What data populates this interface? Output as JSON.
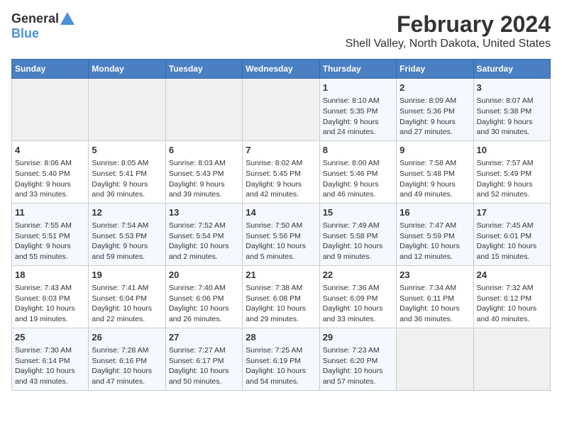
{
  "logo": {
    "general": "General",
    "blue": "Blue"
  },
  "title": "February 2024",
  "subtitle": "Shell Valley, North Dakota, United States",
  "weekdays": [
    "Sunday",
    "Monday",
    "Tuesday",
    "Wednesday",
    "Thursday",
    "Friday",
    "Saturday"
  ],
  "weeks": [
    [
      {
        "day": "",
        "content": ""
      },
      {
        "day": "",
        "content": ""
      },
      {
        "day": "",
        "content": ""
      },
      {
        "day": "",
        "content": ""
      },
      {
        "day": "1",
        "content": "Sunrise: 8:10 AM\nSunset: 5:35 PM\nDaylight: 9 hours\nand 24 minutes."
      },
      {
        "day": "2",
        "content": "Sunrise: 8:09 AM\nSunset: 5:36 PM\nDaylight: 9 hours\nand 27 minutes."
      },
      {
        "day": "3",
        "content": "Sunrise: 8:07 AM\nSunset: 5:38 PM\nDaylight: 9 hours\nand 30 minutes."
      }
    ],
    [
      {
        "day": "4",
        "content": "Sunrise: 8:06 AM\nSunset: 5:40 PM\nDaylight: 9 hours\nand 33 minutes."
      },
      {
        "day": "5",
        "content": "Sunrise: 8:05 AM\nSunset: 5:41 PM\nDaylight: 9 hours\nand 36 minutes."
      },
      {
        "day": "6",
        "content": "Sunrise: 8:03 AM\nSunset: 5:43 PM\nDaylight: 9 hours\nand 39 minutes."
      },
      {
        "day": "7",
        "content": "Sunrise: 8:02 AM\nSunset: 5:45 PM\nDaylight: 9 hours\nand 42 minutes."
      },
      {
        "day": "8",
        "content": "Sunrise: 8:00 AM\nSunset: 5:46 PM\nDaylight: 9 hours\nand 46 minutes."
      },
      {
        "day": "9",
        "content": "Sunrise: 7:58 AM\nSunset: 5:48 PM\nDaylight: 9 hours\nand 49 minutes."
      },
      {
        "day": "10",
        "content": "Sunrise: 7:57 AM\nSunset: 5:49 PM\nDaylight: 9 hours\nand 52 minutes."
      }
    ],
    [
      {
        "day": "11",
        "content": "Sunrise: 7:55 AM\nSunset: 5:51 PM\nDaylight: 9 hours\nand 55 minutes."
      },
      {
        "day": "12",
        "content": "Sunrise: 7:54 AM\nSunset: 5:53 PM\nDaylight: 9 hours\nand 59 minutes."
      },
      {
        "day": "13",
        "content": "Sunrise: 7:52 AM\nSunset: 5:54 PM\nDaylight: 10 hours\nand 2 minutes."
      },
      {
        "day": "14",
        "content": "Sunrise: 7:50 AM\nSunset: 5:56 PM\nDaylight: 10 hours\nand 5 minutes."
      },
      {
        "day": "15",
        "content": "Sunrise: 7:49 AM\nSunset: 5:58 PM\nDaylight: 10 hours\nand 9 minutes."
      },
      {
        "day": "16",
        "content": "Sunrise: 7:47 AM\nSunset: 5:59 PM\nDaylight: 10 hours\nand 12 minutes."
      },
      {
        "day": "17",
        "content": "Sunrise: 7:45 AM\nSunset: 6:01 PM\nDaylight: 10 hours\nand 15 minutes."
      }
    ],
    [
      {
        "day": "18",
        "content": "Sunrise: 7:43 AM\nSunset: 6:03 PM\nDaylight: 10 hours\nand 19 minutes."
      },
      {
        "day": "19",
        "content": "Sunrise: 7:41 AM\nSunset: 6:04 PM\nDaylight: 10 hours\nand 22 minutes."
      },
      {
        "day": "20",
        "content": "Sunrise: 7:40 AM\nSunset: 6:06 PM\nDaylight: 10 hours\nand 26 minutes."
      },
      {
        "day": "21",
        "content": "Sunrise: 7:38 AM\nSunset: 6:08 PM\nDaylight: 10 hours\nand 29 minutes."
      },
      {
        "day": "22",
        "content": "Sunrise: 7:36 AM\nSunset: 6:09 PM\nDaylight: 10 hours\nand 33 minutes."
      },
      {
        "day": "23",
        "content": "Sunrise: 7:34 AM\nSunset: 6:11 PM\nDaylight: 10 hours\nand 36 minutes."
      },
      {
        "day": "24",
        "content": "Sunrise: 7:32 AM\nSunset: 6:12 PM\nDaylight: 10 hours\nand 40 minutes."
      }
    ],
    [
      {
        "day": "25",
        "content": "Sunrise: 7:30 AM\nSunset: 6:14 PM\nDaylight: 10 hours\nand 43 minutes."
      },
      {
        "day": "26",
        "content": "Sunrise: 7:28 AM\nSunset: 6:16 PM\nDaylight: 10 hours\nand 47 minutes."
      },
      {
        "day": "27",
        "content": "Sunrise: 7:27 AM\nSunset: 6:17 PM\nDaylight: 10 hours\nand 50 minutes."
      },
      {
        "day": "28",
        "content": "Sunrise: 7:25 AM\nSunset: 6:19 PM\nDaylight: 10 hours\nand 54 minutes."
      },
      {
        "day": "29",
        "content": "Sunrise: 7:23 AM\nSunset: 6:20 PM\nDaylight: 10 hours\nand 57 minutes."
      },
      {
        "day": "",
        "content": ""
      },
      {
        "day": "",
        "content": ""
      }
    ]
  ]
}
